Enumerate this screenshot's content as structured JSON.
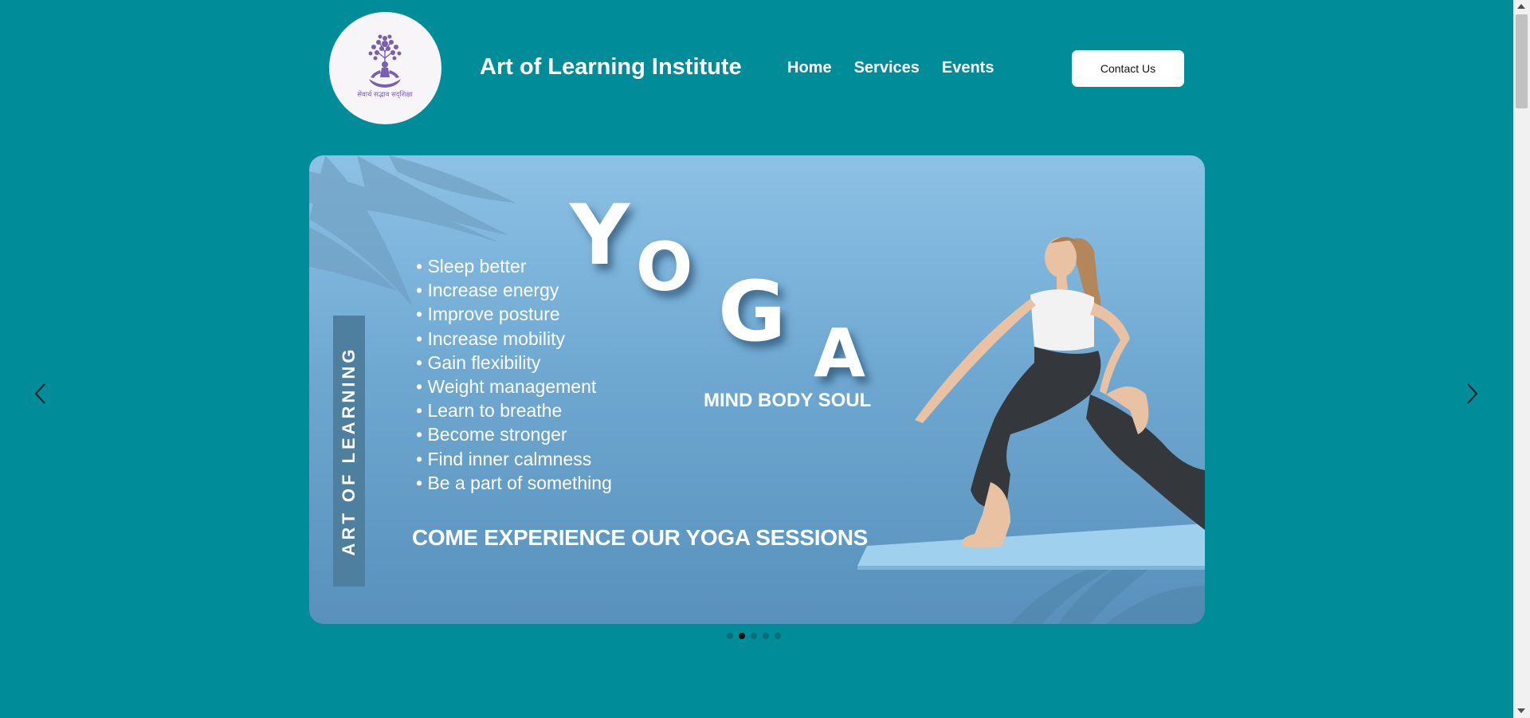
{
  "site": {
    "title": "Art of Learning Institute",
    "logo_caption": "सेवार्थ सद्भाव सद्शिक्षा",
    "logo_icon": "tree-meditation-icon"
  },
  "nav": {
    "items": [
      {
        "label": "Home"
      },
      {
        "label": "Services"
      },
      {
        "label": "Events"
      }
    ],
    "contact_label": "Contact Us"
  },
  "slide": {
    "vertical_text": "ART OF LEARNING",
    "heading_letters": [
      "Y",
      "O",
      "G",
      "A"
    ],
    "tagline": "MIND BODY SOUL",
    "benefits": [
      "Sleep better",
      "Increase energy",
      "Improve posture",
      "Increase mobility",
      "Gain flexibility",
      "Weight management",
      "Learn to breathe",
      "Become stronger",
      "Find inner calmness",
      "Be a part of something"
    ],
    "cta": "COME EXPERIENCE OUR YOGA SESSIONS"
  },
  "carousel": {
    "prev_icon": "chevron-left-icon",
    "next_icon": "chevron-right-icon",
    "slide_count": 5,
    "active_index": 1
  },
  "colors": {
    "background": "#008c99",
    "logo_purple": "#7a5fb0",
    "slide_blue": "#6fa9d2"
  }
}
